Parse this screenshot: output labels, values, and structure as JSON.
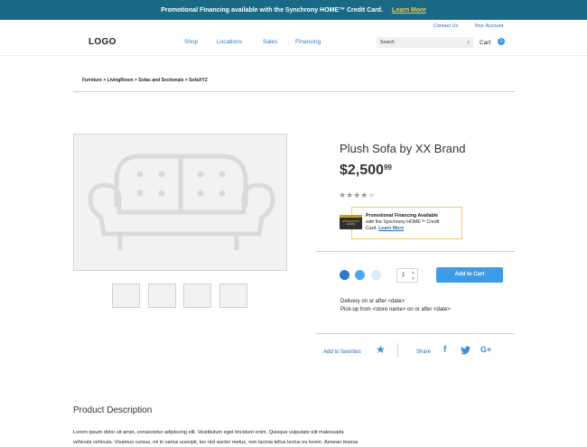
{
  "promo": {
    "text": "Promotional Financing available with the Synchrony HOME™ Credit Card.",
    "learn_more": "Learn More"
  },
  "header": {
    "utility": {
      "contact": "Contact Us",
      "account": "Your Account"
    },
    "logo": "LOGO",
    "nav": [
      "Shop",
      "Locations",
      "Sales",
      "Financing"
    ],
    "search": {
      "placeholder": "Search",
      "icon": "chevron-right-icon"
    },
    "cart": {
      "label": "Cart",
      "count": "1"
    }
  },
  "breadcrumb": "Furniture > LivingRoom > Sofas and Sectionals > SofaXYZ",
  "product": {
    "title": "Plush Sofa by XX Brand",
    "price_main": "$2,500",
    "price_cents": "99",
    "rating": {
      "value": 4,
      "max": 5
    },
    "financing": {
      "card_label": "SYNCHRONY HOME",
      "heading": "Promotional Financing Available",
      "line1": "with the Synchrony HOME™ Credit",
      "line2_prefix": "Card.",
      "learn_more": "Learn More"
    },
    "swatches": [
      {
        "name": "swatch-dark-blue",
        "color": "#2f78c8"
      },
      {
        "name": "swatch-medium-blue",
        "color": "#4ea6ee"
      },
      {
        "name": "swatch-light-blue",
        "color": "#d8ebfb"
      }
    ],
    "quantity": "1",
    "add_to_cart": "Add to Cart",
    "delivery": "Delivery on or after <date>",
    "pickup": "Pick-up from <store name> on or after <date>",
    "favorites": "Add to favorites",
    "share": "Share",
    "social_icons": [
      "facebook-icon",
      "twitter-icon",
      "google-plus-icon"
    ]
  },
  "description": {
    "title": "Product Description",
    "line1": "Lorem ipsum dolor sit amet, consectetur adipiscing elit. Vestibulum eget tincidunt enim. Quisque vulputate elit malesuada",
    "line2": "vehicula vehicula. Vivamus cursus, mi in varius suscipit, leo nisl auctor metus, non lacinia tellus lectus eu lorem. Aenean massa"
  },
  "colors": {
    "promo_bar": "#1a6a86",
    "accent_blue": "#3d9be8",
    "link_blue": "#2b6cb0",
    "learn_more_yellow": "#f3c64a",
    "finance_border": "#f0cd62"
  }
}
